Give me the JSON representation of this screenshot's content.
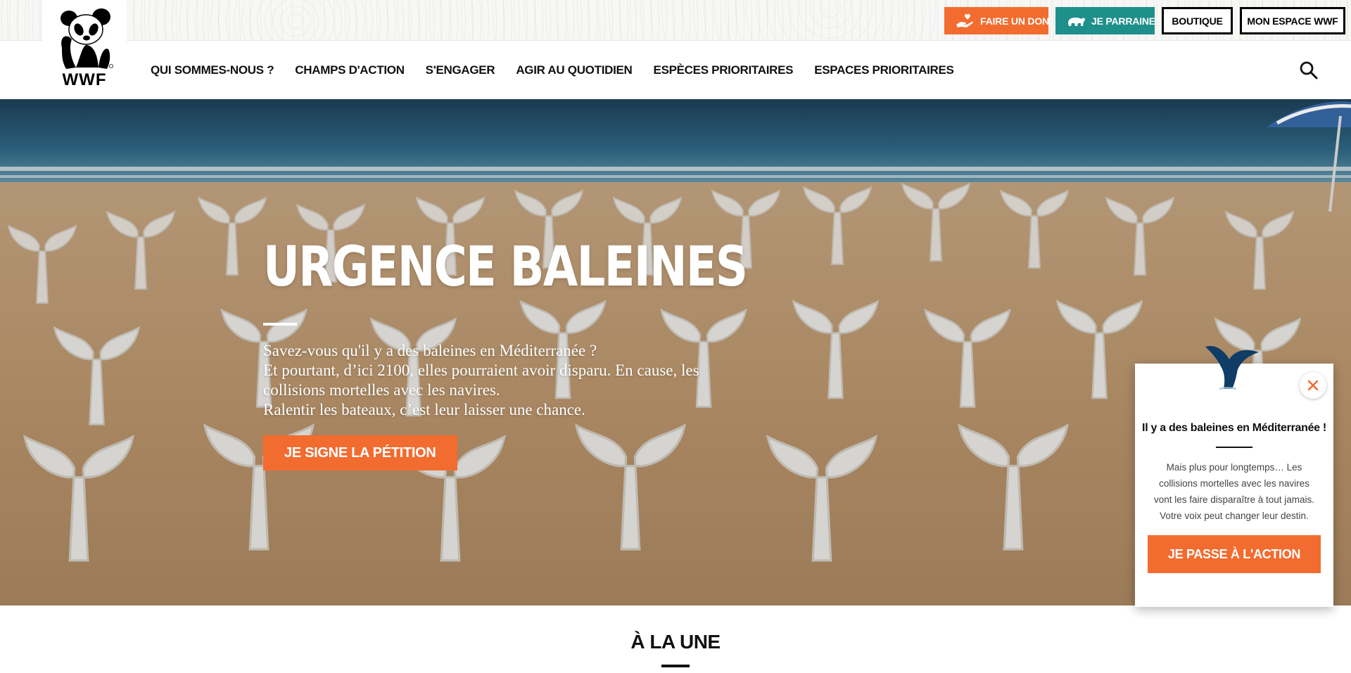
{
  "brand": {
    "name": "WWF",
    "accent": "#f26c2f",
    "teal": "#1e8f8a"
  },
  "top_actions": {
    "donate": {
      "label": "FAIRE UN DON",
      "icon": "hand-heart-icon"
    },
    "sponsor": {
      "label": "JE PARRAINE",
      "icon": "bear-icon"
    },
    "shop": {
      "label": "BOUTIQUE"
    },
    "account": {
      "label": "MON ESPACE WWF"
    }
  },
  "nav": {
    "items": [
      {
        "label": "QUI SOMMES-NOUS ?"
      },
      {
        "label": "CHAMPS D'ACTION"
      },
      {
        "label": "S'ENGAGER"
      },
      {
        "label": "AGIR AU QUOTIDIEN"
      },
      {
        "label": "ESPÈCES PRIORITAIRES"
      },
      {
        "label": "ESPACES PRIORITAIRES"
      }
    ],
    "search_icon": "search-icon"
  },
  "hero": {
    "title": "URGENCE BALEINES",
    "lines": [
      "Savez-vous qu'il y a des baleines en Méditerranée ?",
      "Et pourtant, d’ici 2100, elles pourraient avoir disparu. En cause, les collisions mortelles avec les navires.",
      "Ralentir les bateaux, c’est leur laisser une chance."
    ],
    "cta": "JE SIGNE LA PÉTITION"
  },
  "section": {
    "title": "À LA UNE"
  },
  "popup": {
    "title": "Il y a des baleines en Méditerranée !",
    "text": "Mais plus pour longtemps… Les collisions mortelles avec les navires vont les faire disparaître à tout jamais. Votre voix peut changer leur destin.",
    "cta": "JE PASSE À L'ACTION",
    "close_icon": "close-icon"
  }
}
